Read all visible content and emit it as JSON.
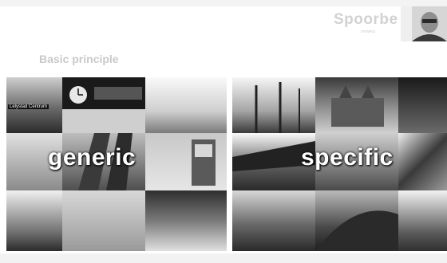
{
  "slide": {
    "brand": "Spoorbe",
    "brand_sub": "ontwerp",
    "heading": "Basic principle",
    "left_label": "generic",
    "right_label": "specific",
    "tile_sign": "Lelystad Centrum"
  }
}
